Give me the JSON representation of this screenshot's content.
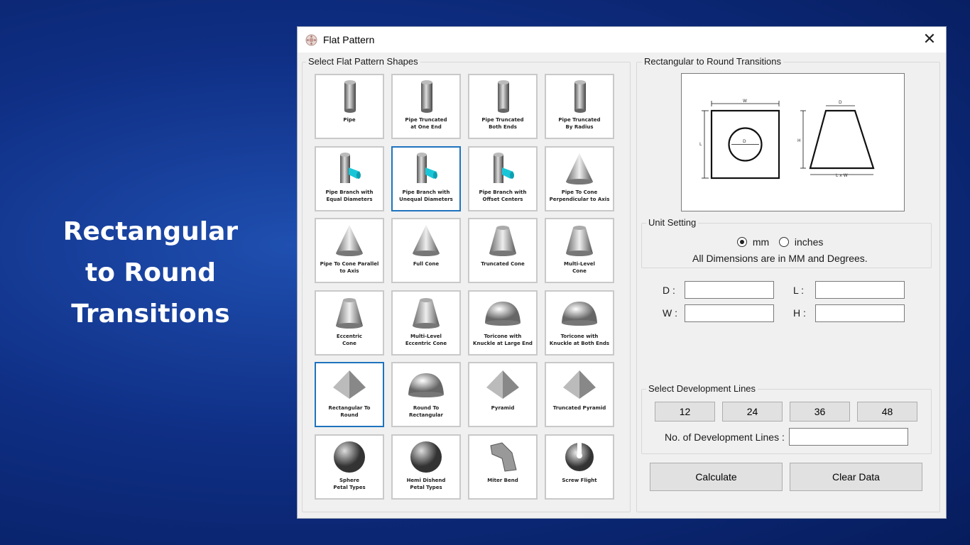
{
  "hero": {
    "line1": "Rectangular",
    "line2": "to Round",
    "line3": "Transitions"
  },
  "window": {
    "title": "Flat Pattern",
    "close": "✕"
  },
  "shapes_group": {
    "title": "Select Flat Pattern Shapes"
  },
  "shapes": [
    {
      "label": "Pipe",
      "icon": "pipe-icon"
    },
    {
      "label": "Pipe Truncated\nat One End",
      "icon": "pipe-truncated-one-end-icon"
    },
    {
      "label": "Pipe Truncated\nBoth Ends",
      "icon": "pipe-truncated-both-ends-icon"
    },
    {
      "label": "Pipe Truncated\nBy Radius",
      "icon": "pipe-truncated-radius-icon"
    },
    {
      "label": "Pipe Branch with\nEqual Diameters",
      "icon": "pipe-branch-equal-icon"
    },
    {
      "label": "Pipe Branch with\nUnequal Diameters",
      "icon": "pipe-branch-unequal-icon"
    },
    {
      "label": "Pipe Branch with\nOffset Centers",
      "icon": "pipe-branch-offset-icon"
    },
    {
      "label": "Pipe To Cone\nPerpendicular to Axis",
      "icon": "pipe-to-cone-perpendicular-icon"
    },
    {
      "label": "Pipe To Cone Parallel\nto Axis",
      "icon": "pipe-to-cone-parallel-icon"
    },
    {
      "label": "Full Cone",
      "icon": "full-cone-icon"
    },
    {
      "label": "Truncated Cone",
      "icon": "truncated-cone-icon"
    },
    {
      "label": "Multi-Level\nCone",
      "icon": "multi-level-cone-icon"
    },
    {
      "label": "Eccentric\nCone",
      "icon": "eccentric-cone-icon"
    },
    {
      "label": "Multi-Level\nEccentric Cone",
      "icon": "multi-level-eccentric-cone-icon"
    },
    {
      "label": "Toricone with\nKnuckle at Large End",
      "icon": "toricone-large-end-icon"
    },
    {
      "label": "Toricone with\nKnuckle at Both Ends",
      "icon": "toricone-both-ends-icon"
    },
    {
      "label": "Rectangular To\nRound",
      "icon": "rectangular-to-round-icon"
    },
    {
      "label": "Round To\nRectangular",
      "icon": "round-to-rectangular-icon"
    },
    {
      "label": "Pyramid",
      "icon": "pyramid-icon"
    },
    {
      "label": "Truncated Pyramid",
      "icon": "truncated-pyramid-icon"
    },
    {
      "label": "Sphere\nPetal Types",
      "icon": "sphere-icon"
    },
    {
      "label": "Hemi Dishend\nPetal Types",
      "icon": "hemi-dishend-icon"
    },
    {
      "label": "Miter Bend",
      "icon": "miter-bend-icon"
    },
    {
      "label": "Screw Flight",
      "icon": "screw-flight-icon"
    }
  ],
  "selected_shape_index": 16,
  "hovered_shape_index": 5,
  "preview_group": {
    "title": "Rectangular to Round Transitions",
    "dim_w": "W",
    "dim_d_top": "D",
    "dim_d_circle": "D",
    "dim_l": "L",
    "dim_h": "H",
    "dim_lxw": "L x W"
  },
  "unit_setting": {
    "title": "Unit Setting",
    "option_mm": "mm",
    "option_inches": "inches",
    "selected": "mm",
    "note": "All Dimensions are in MM and Degrees."
  },
  "dimensions": {
    "d_label": "D :",
    "d_value": "",
    "l_label": "L :",
    "l_value": "",
    "w_label": "W :",
    "w_value": "",
    "h_label": "H :",
    "h_value": ""
  },
  "development_lines": {
    "title": "Select Development Lines",
    "options": [
      "12",
      "24",
      "36",
      "48"
    ],
    "count_label": "No. of Development Lines :",
    "count_value": ""
  },
  "actions": {
    "calculate": "Calculate",
    "clear": "Clear Data"
  },
  "colors": {
    "accent": "#1e73be",
    "branch_pipe": "#19c6d8"
  }
}
